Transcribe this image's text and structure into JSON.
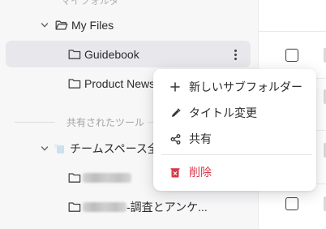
{
  "sidebar": {
    "top_faded_label": "マイフォルダ",
    "my_files_label": "My Files",
    "guidebook_label": "Guidebook",
    "product_news_label": "Product News",
    "shared_section_label": "共有されたツール",
    "team_space_label": "チームスペース全",
    "last_item_suffix": "-調査とアンケ..."
  },
  "context_menu": {
    "items": [
      {
        "label": "新しいサブフォルダー",
        "icon": "plus-icon"
      },
      {
        "label": "タイトル変更",
        "icon": "pencil-icon"
      },
      {
        "label": "共有",
        "icon": "share-icon"
      },
      {
        "label": "削除",
        "icon": "trash-icon"
      }
    ]
  },
  "colors": {
    "danger": "#d6394a",
    "selected_row": "#e8e8ec",
    "sidebar_bg": "#f7f7f8"
  }
}
